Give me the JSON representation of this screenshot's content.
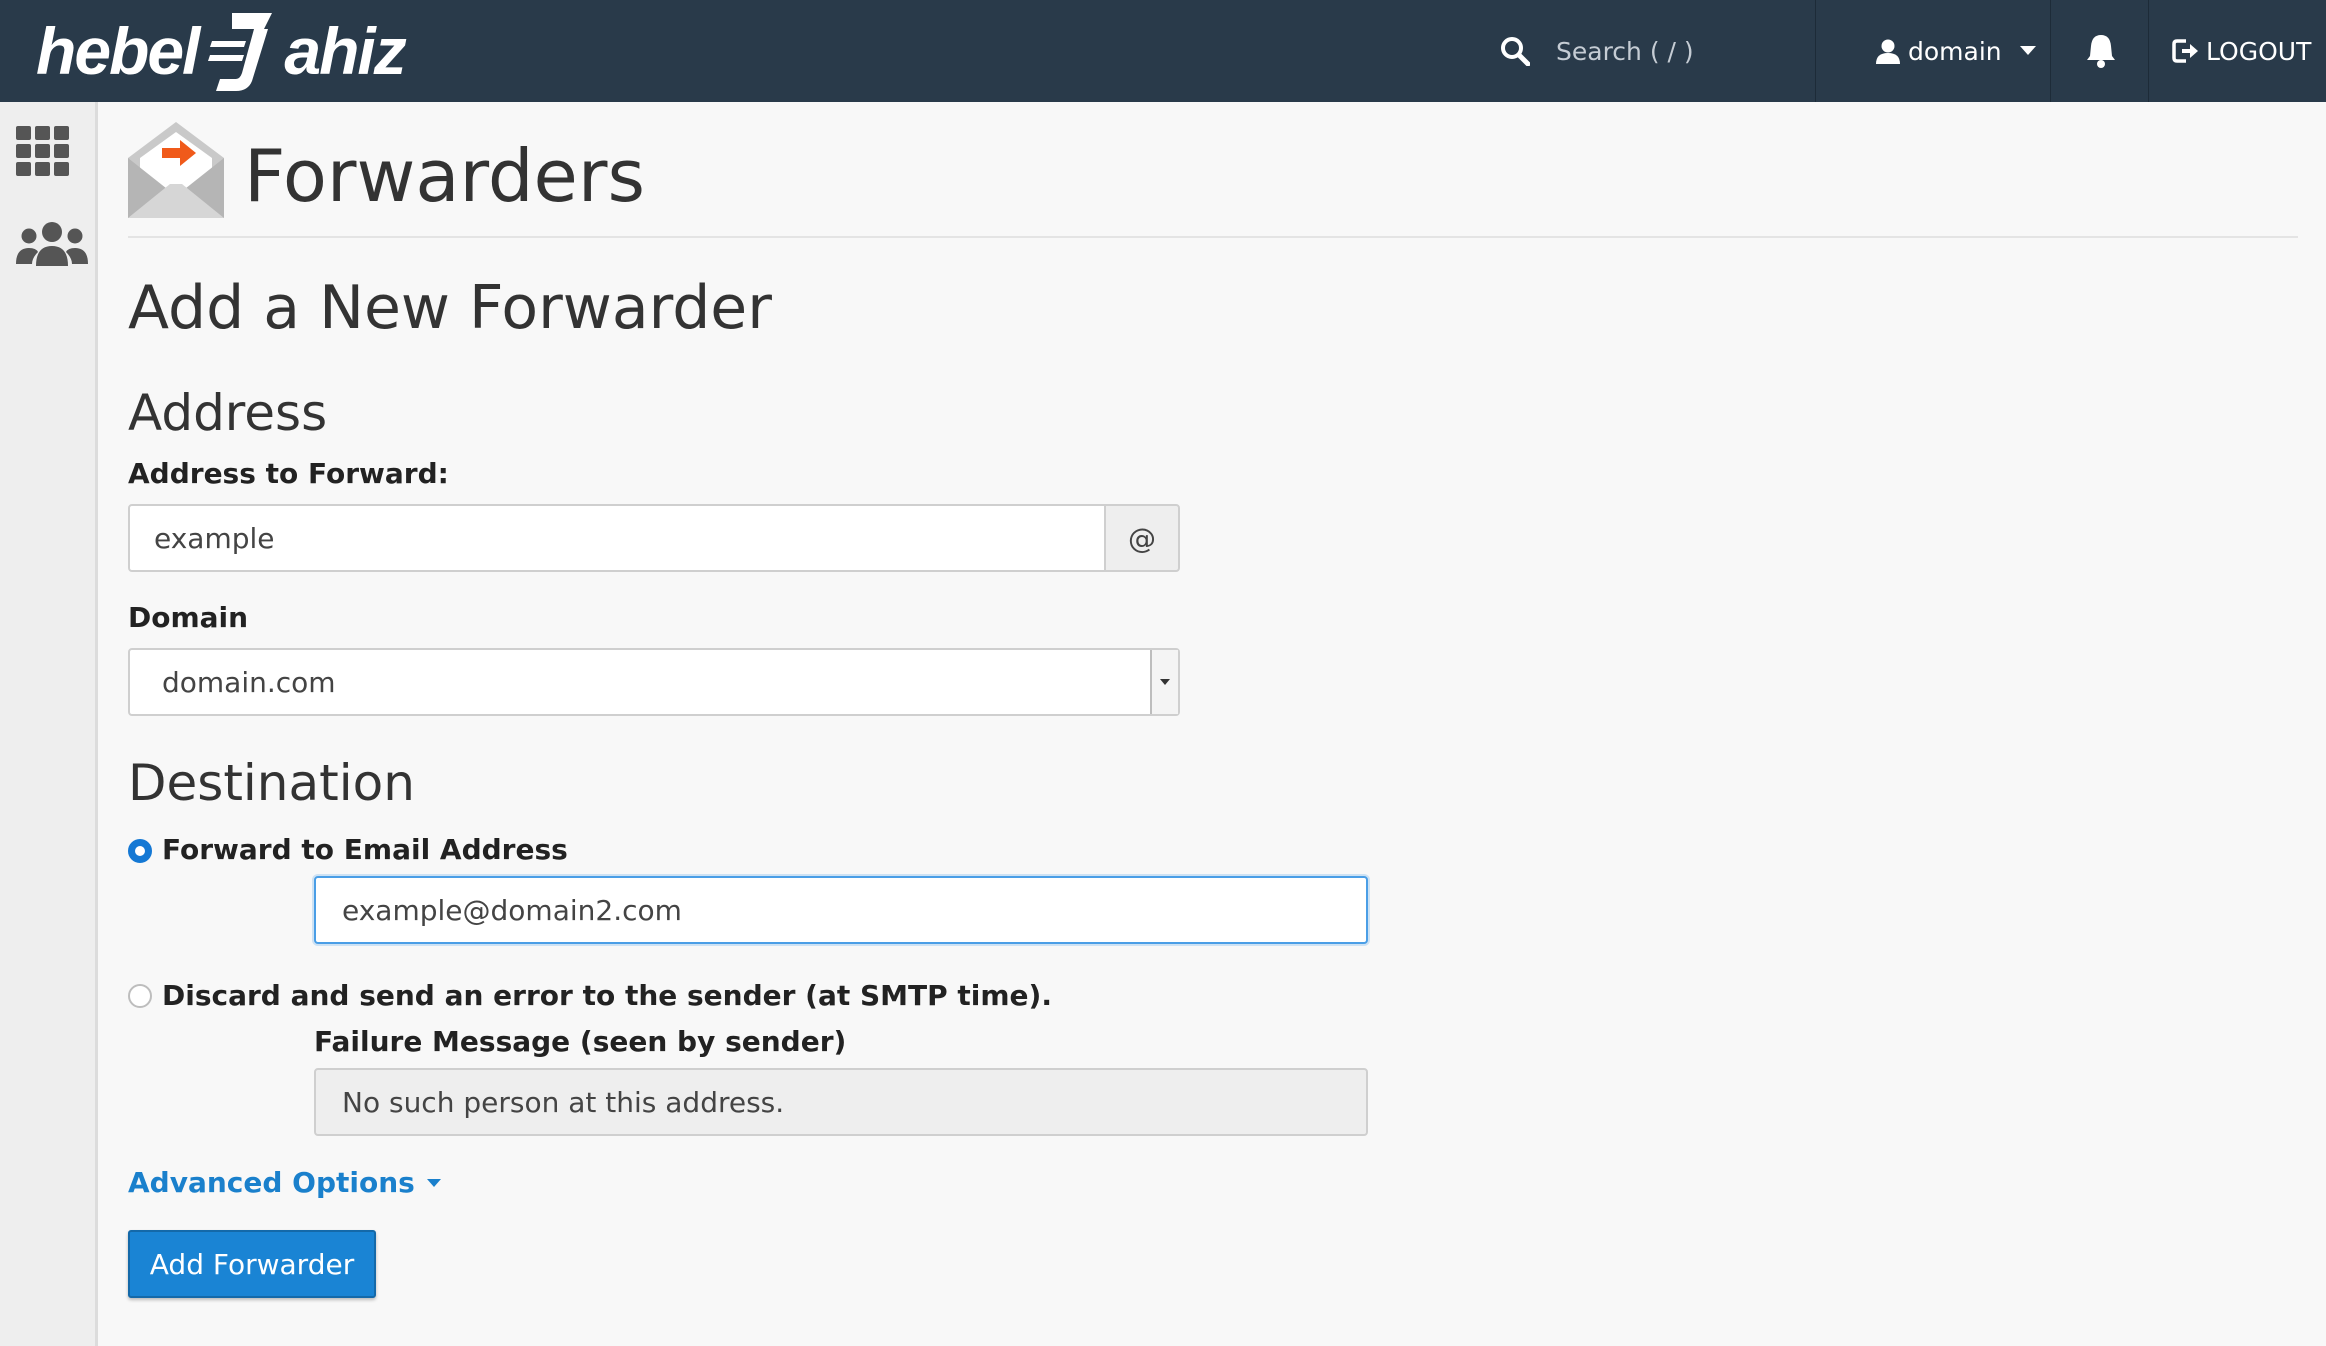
{
  "brand": {
    "logo_text_left": "hebel",
    "logo_text_right": "ahiz"
  },
  "topbar": {
    "search_placeholder": "Search ( / )",
    "user_label": "domain",
    "logout_label": "LOGOUT"
  },
  "sidebar": {
    "items": [
      {
        "icon": "apps-grid-icon"
      },
      {
        "icon": "users-icon"
      }
    ]
  },
  "page": {
    "title": "Forwarders",
    "section_title": "Add a New Forwarder"
  },
  "address": {
    "heading": "Address",
    "forward_label": "Address to Forward:",
    "forward_value": "example",
    "at_sign": "@",
    "domain_label": "Domain",
    "domain_value": "domain.com"
  },
  "destination": {
    "heading": "Destination",
    "option_forward_label": "Forward to Email Address",
    "forward_email_value": "example@domain2.com",
    "option_discard_label": "Discard and send an error to the sender (at SMTP time).",
    "failure_label": "Failure Message (seen by sender)",
    "failure_value": "No such person at this address."
  },
  "advanced_label": "Advanced Options",
  "add_button_label": "Add Forwarder",
  "colors": {
    "topbar": "#293a4a",
    "primary": "#1a84d4",
    "link": "#1a80cc",
    "accent_orange": "#f05a1a"
  }
}
